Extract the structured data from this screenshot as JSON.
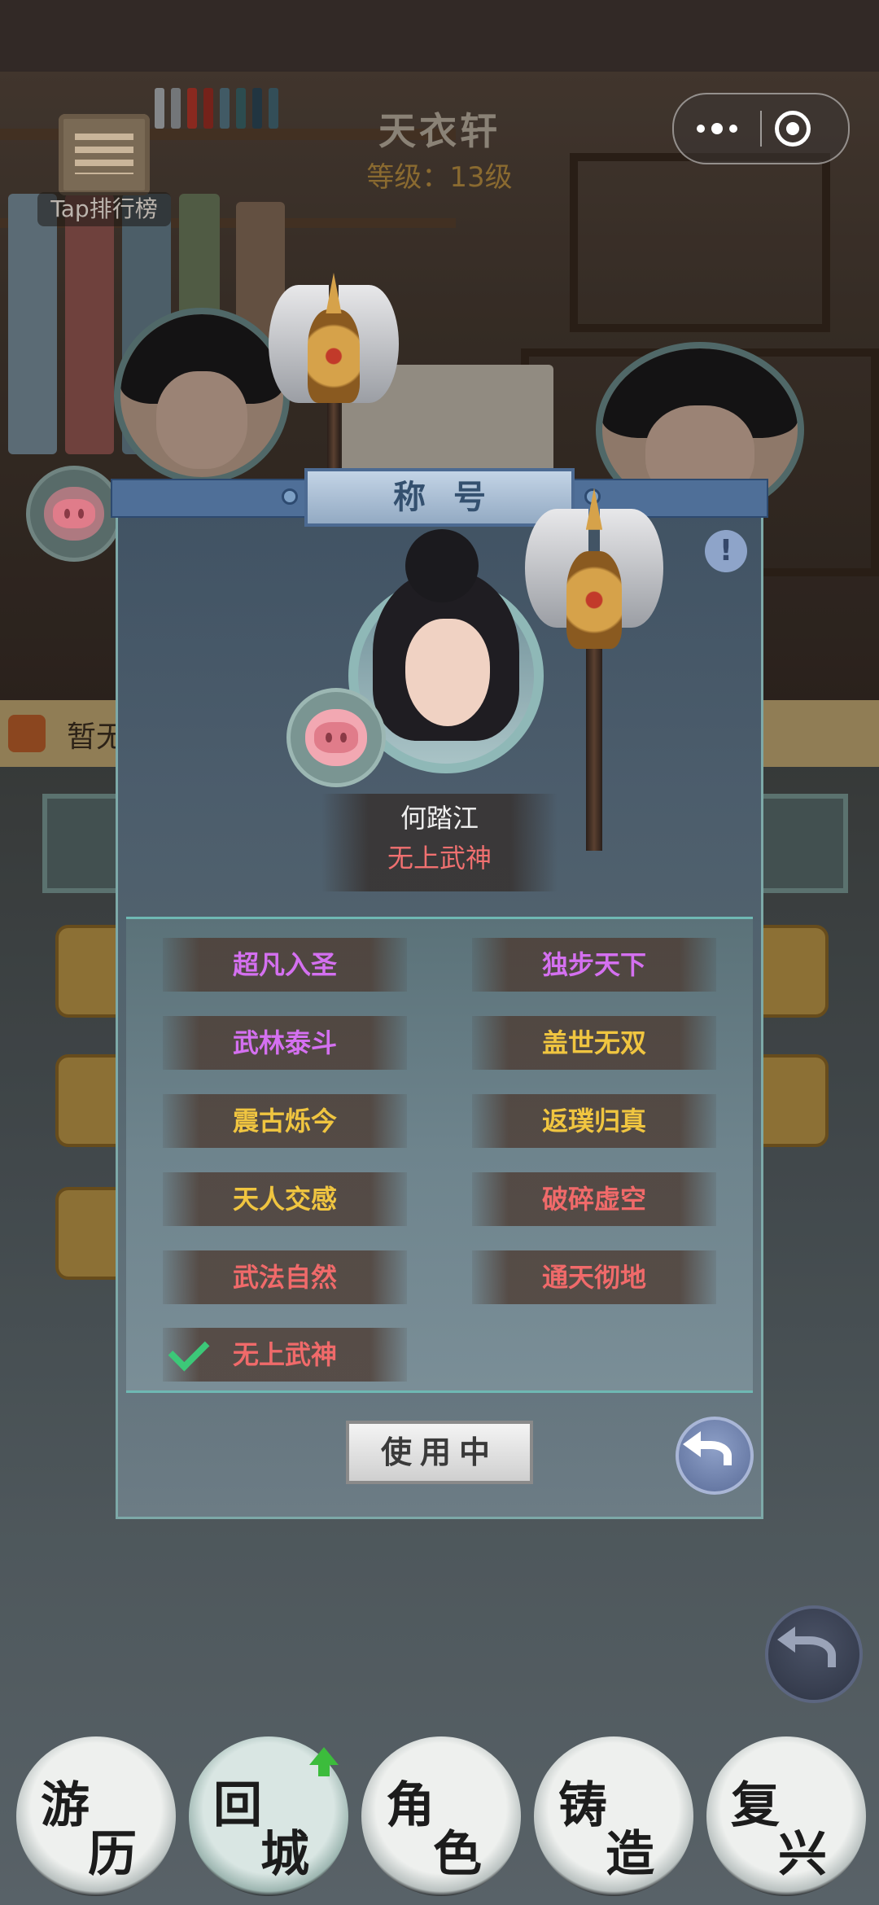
{
  "header": {
    "title": "天衣轩",
    "level": "等级：13级"
  },
  "leaderboard": {
    "label": "Tap排行榜"
  },
  "notice": {
    "text": "暂无"
  },
  "modal": {
    "title": "称号",
    "player": {
      "name": "何踏江",
      "title": "无上武神"
    },
    "titles": [
      {
        "label": "超凡入圣",
        "color": "#d470f0"
      },
      {
        "label": "独步天下",
        "color": "#d470f0"
      },
      {
        "label": "武林泰斗",
        "color": "#d470f0"
      },
      {
        "label": "盖世无双",
        "color": "#f0c540"
      },
      {
        "label": "震古烁今",
        "color": "#f0c540"
      },
      {
        "label": "返璞归真",
        "color": "#f0c540"
      },
      {
        "label": "天人交感",
        "color": "#f0c540"
      },
      {
        "label": "破碎虚空",
        "color": "#f06a6a"
      },
      {
        "label": "武法自然",
        "color": "#f06a6a"
      },
      {
        "label": "通天彻地",
        "color": "#f06a6a"
      },
      {
        "label": "无上武神",
        "color": "#f06a6a",
        "selected": true
      }
    ],
    "use_button": "使用中"
  },
  "nav": [
    {
      "c1": "游",
      "c2": "历"
    },
    {
      "c1": "回",
      "c2": "城",
      "badge": "up-arrow-icon"
    },
    {
      "c1": "角",
      "c2": "色"
    },
    {
      "c1": "铸",
      "c2": "造"
    },
    {
      "c1": "复",
      "c2": "兴"
    }
  ]
}
